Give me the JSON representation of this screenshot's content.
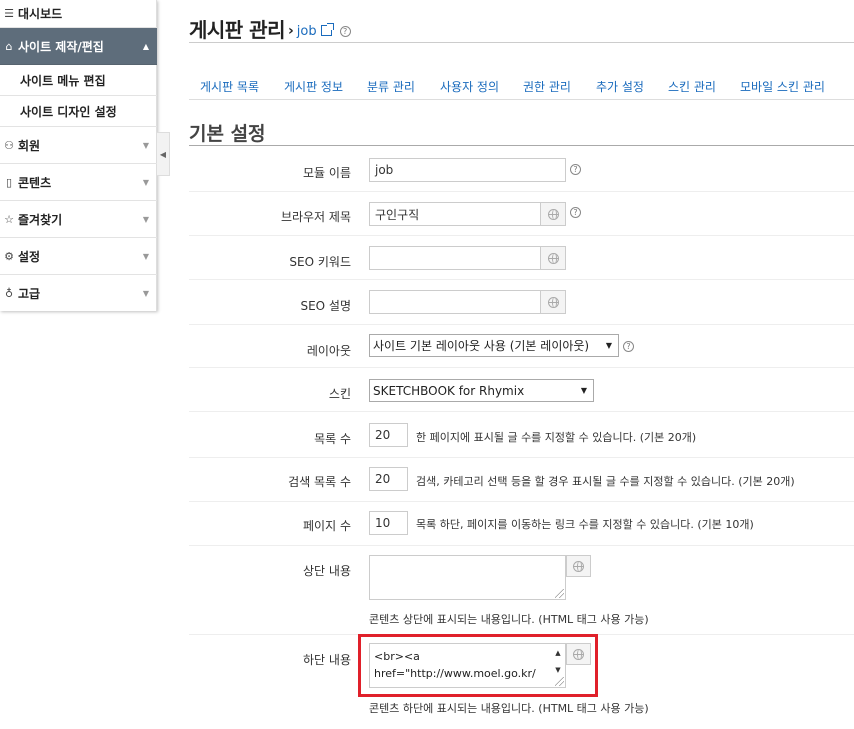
{
  "sidebar": {
    "items": [
      {
        "icon": "menu-icon",
        "label": "대시보드"
      },
      {
        "icon": "home-icon",
        "label": "사이트 제작/편집"
      },
      {
        "label": "사이트 메뉴 편집"
      },
      {
        "label": "사이트 디자인 설정"
      },
      {
        "icon": "users-icon",
        "label": "회원"
      },
      {
        "icon": "document-icon",
        "label": "콘텐츠"
      },
      {
        "icon": "star-icon",
        "label": "즐겨찾기"
      },
      {
        "icon": "gear-icon",
        "label": "설정"
      },
      {
        "icon": "bulb-icon",
        "label": "고급"
      }
    ]
  },
  "header": {
    "title": "게시판 관리",
    "breadcrumb_arrow": "›",
    "breadcrumb_link": "job"
  },
  "tabs": [
    "게시판 목록",
    "게시판 정보",
    "분류 관리",
    "사용자 정의",
    "권한 관리",
    "추가 설정",
    "스킨 관리",
    "모바일 스킨 관리"
  ],
  "section": {
    "title": "기본 설정"
  },
  "form": {
    "module_name": {
      "label": "모듈 이름",
      "value": "job"
    },
    "browser_title": {
      "label": "브라우저 제목",
      "value": "구인구직"
    },
    "seo_keyword": {
      "label": "SEO 키워드",
      "value": ""
    },
    "seo_desc": {
      "label": "SEO 설명",
      "value": ""
    },
    "layout": {
      "label": "레이아웃",
      "value": "사이트 기본 레이아웃 사용 (기본 레이아웃)"
    },
    "skin": {
      "label": "스킨",
      "value": "SKETCHBOOK for Rhymix"
    },
    "list_count": {
      "label": "목록 수",
      "value": "20",
      "hint": "한 페이지에 표시될 글 수를 지정할 수 있습니다. (기본 20개)"
    },
    "search_list_count": {
      "label": "검색 목록 수",
      "value": "20",
      "hint": "검색, 카테고리 선택 등을 할 경우 표시될 글 수를 지정할 수 있습니다. (기본 20개)"
    },
    "page_count": {
      "label": "페이지 수",
      "value": "10",
      "hint": "목록 하단, 페이지를 이동하는 링크 수를 지정할 수 있습니다. (기본 10개)"
    },
    "header_text": {
      "label": "상단 내용",
      "value": "",
      "hint": "콘텐츠 상단에 표시되는 내용입니다. (HTML 태그 사용 가능)"
    },
    "footer_text": {
      "label": "하단 내용",
      "value": "<br><a href=\"http://www.moel.go.kr/",
      "hint": "콘텐츠 하단에 표시되는 내용입니다. (HTML 태그 사용 가능)"
    }
  },
  "colors": {
    "accent": "#1a6bbd",
    "sidebar_active": "#5e6d7b",
    "highlight": "#e0202a"
  }
}
